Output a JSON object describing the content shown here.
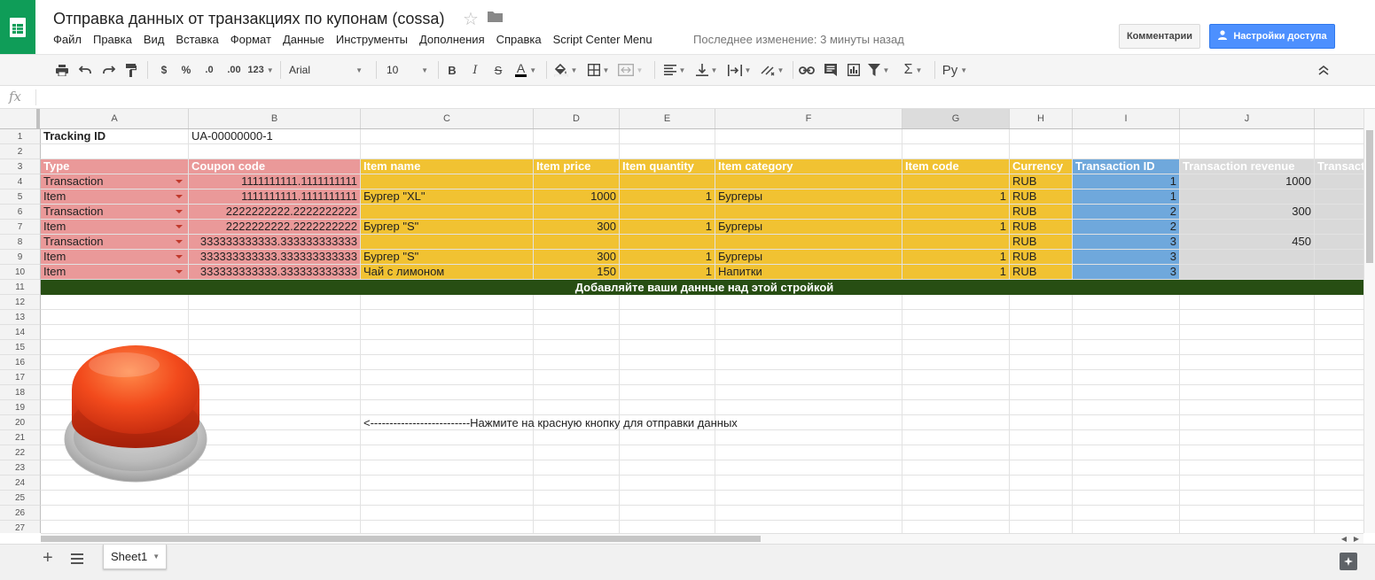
{
  "header": {
    "title": "Отправка данных от транзакциях по купонам (cossa)",
    "menu": [
      "Файл",
      "Правка",
      "Вид",
      "Вставка",
      "Формат",
      "Данные",
      "Инструменты",
      "Дополнения",
      "Справка",
      "Script Center Menu"
    ],
    "last_edit": "Последнее изменение: 3 минуты назад",
    "comments_label": "Комментарии",
    "share_label": "Настройки доступа"
  },
  "toolbar": {
    "currency": "$",
    "percent": "%",
    "decimal_decrease": ".0",
    "decimal_increase": ".00",
    "more_formats": "123",
    "font": "Arial",
    "font_size": "10",
    "bold": "B",
    "italic": "I",
    "strike": "S",
    "text_color": "A",
    "sum": "Σ",
    "input_tools": "Ру"
  },
  "formula_bar": {
    "fx": "fx",
    "value": ""
  },
  "columns": [
    "A",
    "B",
    "C",
    "D",
    "E",
    "F",
    "G",
    "H",
    "I",
    "J",
    ""
  ],
  "rows": [
    "1",
    "2",
    "3",
    "4",
    "5",
    "6",
    "7",
    "8",
    "9",
    "10",
    "11",
    "12",
    "13",
    "14",
    "15",
    "16",
    "17",
    "18",
    "19",
    "20",
    "21",
    "22",
    "23",
    "24",
    "25",
    "26",
    "27"
  ],
  "tracking": {
    "label": "Tracking ID",
    "value": "UA-00000000-1"
  },
  "table_headers": [
    "Type",
    "Coupon code",
    "Item name",
    "Item price",
    "Item quantity",
    "Item category",
    "Item code",
    "Currency",
    "Transaction ID",
    "Transaction revenue",
    "Transact"
  ],
  "table_rows": [
    [
      "Transaction",
      "1111111111.1111111111",
      "",
      "",
      "",
      "",
      "",
      "RUB",
      "1",
      "1000",
      ""
    ],
    [
      "Item",
      "1111111111.1111111111",
      "Бургер \"XL\"",
      "1000",
      "1",
      "Бургеры",
      "1",
      "RUB",
      "1",
      "",
      ""
    ],
    [
      "Transaction",
      "2222222222.2222222222",
      "",
      "",
      "",
      "",
      "",
      "RUB",
      "2",
      "300",
      ""
    ],
    [
      "Item",
      "2222222222.2222222222",
      "Бургер \"S\"",
      "300",
      "1",
      "Бургеры",
      "1",
      "RUB",
      "2",
      "",
      ""
    ],
    [
      "Transaction",
      "333333333333.333333333333",
      "",
      "",
      "",
      "",
      "",
      "RUB",
      "3",
      "450",
      ""
    ],
    [
      "Item",
      "333333333333.333333333333",
      "Бургер \"S\"",
      "300",
      "1",
      "Бургеры",
      "1",
      "RUB",
      "3",
      "",
      ""
    ],
    [
      "Item",
      "333333333333.333333333333",
      "Чай с лимоном",
      "150",
      "1",
      "Напитки",
      "1",
      "RUB",
      "3",
      "",
      ""
    ]
  ],
  "banner": "Добавляйте ваши данные над этой стройкой",
  "hint": "<--------------------------Нажмите на красную кнопку для отправки данных",
  "sheet_tab": "Sheet1",
  "colors": {
    "brand": "#0f9d58",
    "share_button": "#4d90fe",
    "type_col": "#ea9999",
    "item_cols": "#f1c232",
    "transaction_id_col": "#6fa8dc",
    "revenue_col": "#d9d9d9",
    "banner": "#274e13"
  }
}
